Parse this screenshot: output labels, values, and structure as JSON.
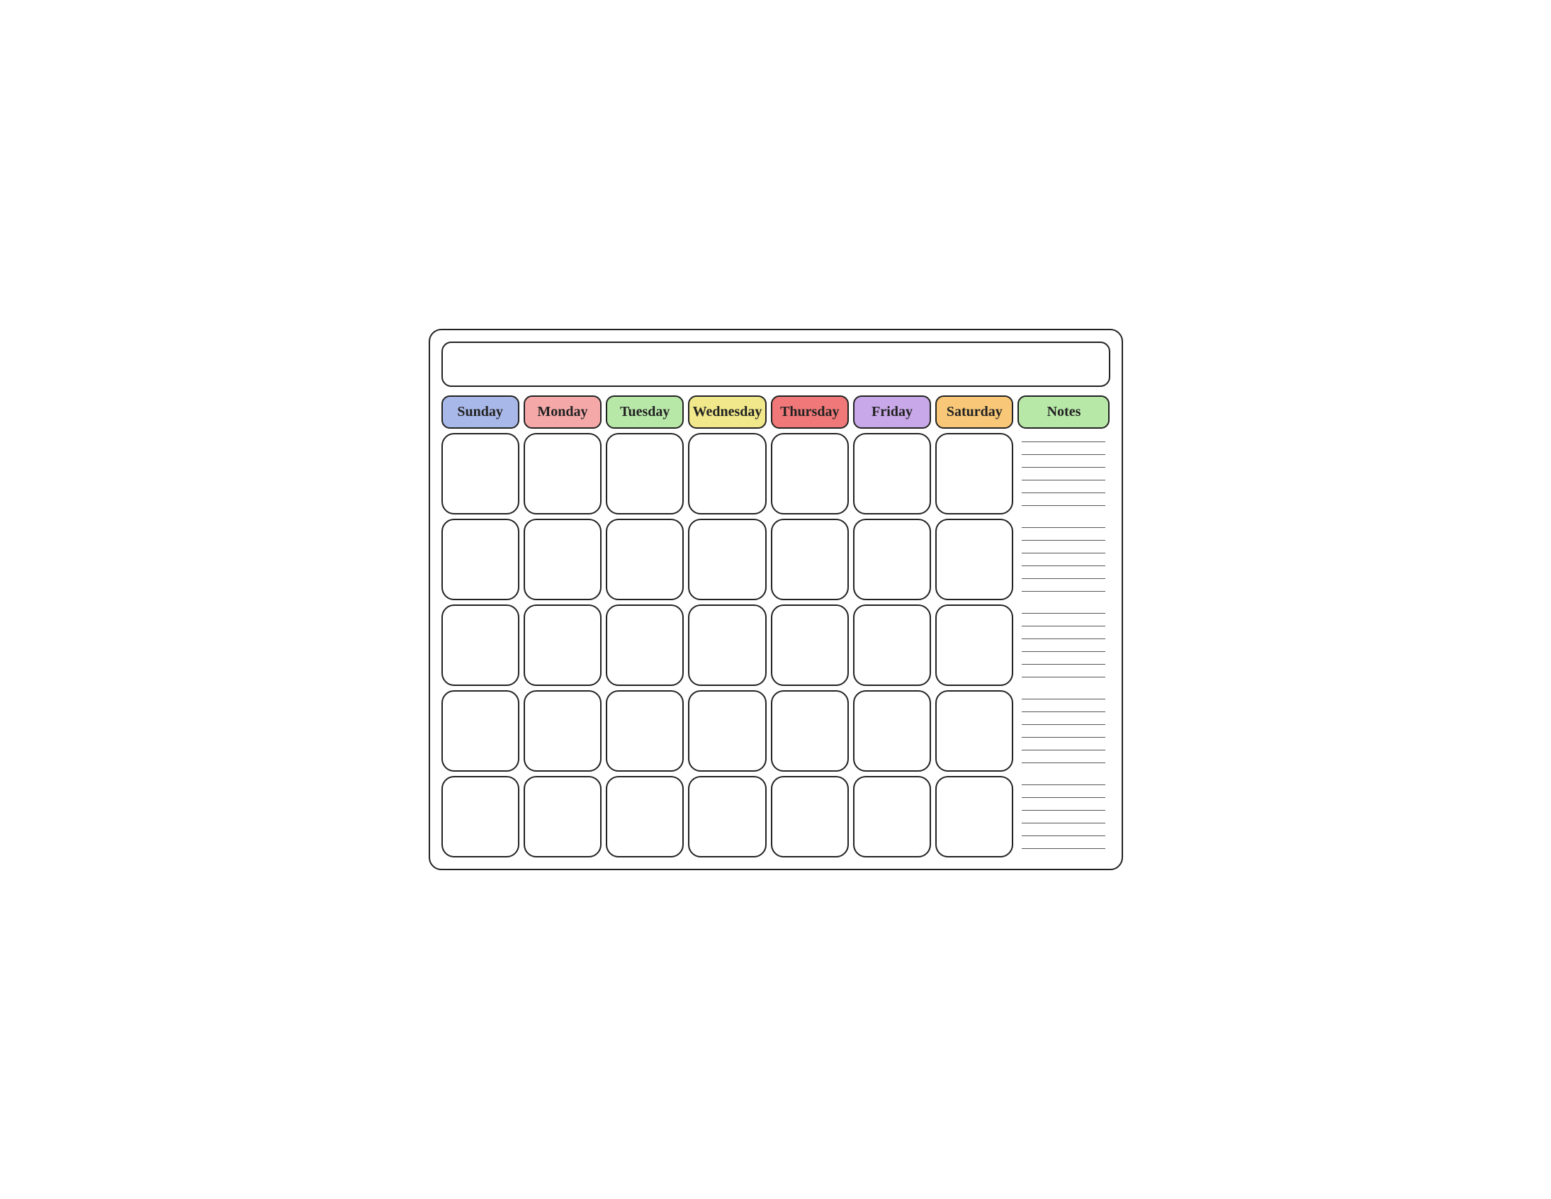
{
  "calendar": {
    "title": "",
    "days": [
      "Sunday",
      "Monday",
      "Tuesday",
      "Wednesday",
      "Thursday",
      "Friday",
      "Saturday"
    ],
    "notes_label": "Notes",
    "rows": 5,
    "notes_lines_per_row": 6
  }
}
